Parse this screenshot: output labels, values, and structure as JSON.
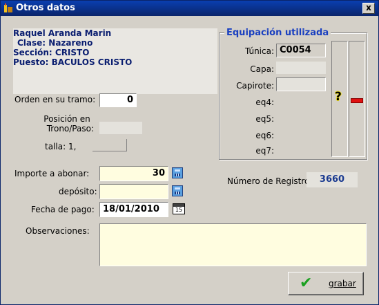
{
  "window": {
    "title": "Otros datos",
    "close_label": "x"
  },
  "person": {
    "name": "Raquel Aranda Marin",
    "clase": "Clase:  Nazareno",
    "seccion": "Sección: CRISTO",
    "puesto": "Puesto:  BACULOS CRISTO"
  },
  "orden": {
    "label": "Orden en su tramo:",
    "value": "0"
  },
  "posicion": {
    "label_line1": "Posición en",
    "label_line2": "Trono/Paso:",
    "value": ""
  },
  "talla": {
    "label": "talla:  1,",
    "value": ""
  },
  "importe": {
    "label": "Importe a abonar:",
    "value": "30"
  },
  "deposito": {
    "label": "depósito:",
    "value": ""
  },
  "fecha": {
    "label": "Fecha de pago:",
    "value": "18/01/2010",
    "picker_day": "15"
  },
  "observaciones": {
    "label": "Observaciones:",
    "value": ""
  },
  "equipacion": {
    "title": "Equipación utilizada",
    "items": [
      {
        "label": "Túnica:",
        "value": "C0054"
      },
      {
        "label": "Capa:",
        "value": ""
      },
      {
        "label": "Capirote:",
        "value": ""
      },
      {
        "label": "eq4:",
        "value": ""
      },
      {
        "label": "eq5:",
        "value": ""
      },
      {
        "label": "eq6:",
        "value": ""
      },
      {
        "label": "eq7:",
        "value": ""
      }
    ]
  },
  "registro": {
    "label": "Número de Registro:",
    "value": "3660"
  },
  "actions": {
    "save_label": "grabar"
  },
  "colors": {
    "title_bar": "#0a246a",
    "info_text": "#0a1e70",
    "group_title": "#1a40c0",
    "yellow_field": "#fffde0"
  }
}
